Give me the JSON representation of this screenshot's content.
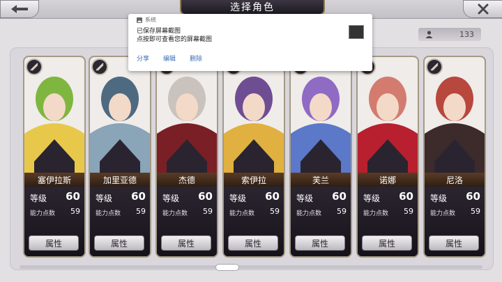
{
  "header": {
    "title": "选择角色"
  },
  "player_count": "133",
  "characters": [
    {
      "name": "塞伊拉斯",
      "level": "60",
      "ability_points": "59"
    },
    {
      "name": "加里亚德",
      "level": "60",
      "ability_points": "59"
    },
    {
      "name": "杰德",
      "level": "60",
      "ability_points": "59"
    },
    {
      "name": "索伊拉",
      "level": "60",
      "ability_points": "59"
    },
    {
      "name": "芙兰",
      "level": "60",
      "ability_points": "59"
    },
    {
      "name": "诺娜",
      "level": "60",
      "ability_points": "59"
    },
    {
      "name": "尼洛",
      "level": "60",
      "ability_points": "59"
    }
  ],
  "labels": {
    "level": "等级",
    "ability_points": "能力点数",
    "attributes": "属性"
  },
  "notification": {
    "app": "系统",
    "title": "已保存屏幕截图",
    "text": "点按即可查看您的屏幕截图",
    "actions": [
      "分享",
      "编辑",
      "删除"
    ]
  },
  "colors": {
    "portraits": [
      "#7fb63f",
      "#4e6a80",
      "#c9c2bd",
      "#6f4d93",
      "#8f6bc4",
      "#d47b6f",
      "#b8473e"
    ],
    "accents": [
      "#e8c84a",
      "#8aa4b8",
      "#7a1f25",
      "#e0b040",
      "#5b78c9",
      "#b81f2f",
      "#3c2b2a"
    ]
  }
}
